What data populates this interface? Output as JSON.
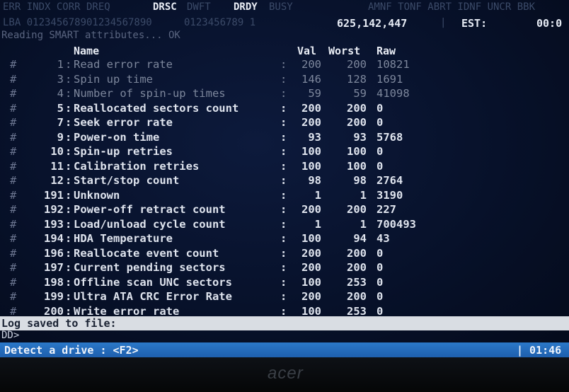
{
  "top": {
    "faded_left": "ERR INDX CORR DREQ",
    "drsc": "DRSC",
    "faded_mid": "DWFT",
    "drdy": "DRDY",
    "faded_mid2": "BUSY",
    "faded_right": "AMNF TONF ABRT IDNF UNCR BBK"
  },
  "info": {
    "faded_left": "LBA 012345678901234567890",
    "faded_mid": "0123456789 1",
    "lba_count": "625,142,447",
    "sep": "|",
    "est_label": "EST:",
    "est_value": "00:0"
  },
  "status_line": "Reading SMART attributes... OK",
  "columns": {
    "name": "Name",
    "val": "Val",
    "worst": "Worst",
    "raw": "Raw"
  },
  "attributes": [
    {
      "mark": "",
      "id": "1",
      "name": "Read error rate",
      "val": "200",
      "worst": "200",
      "raw": "10821",
      "dim": true
    },
    {
      "mark": "",
      "id": "3",
      "name": "Spin up time",
      "val": "146",
      "worst": "128",
      "raw": "1691",
      "dim": true
    },
    {
      "mark": "",
      "id": "4",
      "name": "Number of spin-up times",
      "val": "59",
      "worst": "59",
      "raw": "41098",
      "dim": true
    },
    {
      "mark": "",
      "id": "5",
      "name": "Reallocated sectors count",
      "val": "200",
      "worst": "200",
      "raw": "0",
      "dim": false
    },
    {
      "mark": "",
      "id": "7",
      "name": "Seek error rate",
      "val": "200",
      "worst": "200",
      "raw": "0",
      "dim": false
    },
    {
      "mark": "",
      "id": "9",
      "name": "Power-on time",
      "val": "93",
      "worst": "93",
      "raw": "5768",
      "dim": false
    },
    {
      "mark": "",
      "id": "10",
      "name": "Spin-up retries",
      "val": "100",
      "worst": "100",
      "raw": "0",
      "dim": false
    },
    {
      "mark": "",
      "id": "11",
      "name": "Calibration retries",
      "val": "100",
      "worst": "100",
      "raw": "0",
      "dim": false
    },
    {
      "mark": "",
      "id": "12",
      "name": "Start/stop count",
      "val": "98",
      "worst": "98",
      "raw": "2764",
      "dim": false
    },
    {
      "mark": "",
      "id": "191",
      "name": "Unknown",
      "val": "1",
      "worst": "1",
      "raw": "3190",
      "dim": false
    },
    {
      "mark": "",
      "id": "192",
      "name": "Power-off retract count",
      "val": "200",
      "worst": "200",
      "raw": "227",
      "dim": false
    },
    {
      "mark": "",
      "id": "193",
      "name": "Load/unload cycle count",
      "val": "1",
      "worst": "1",
      "raw": "700493",
      "dim": false
    },
    {
      "mark": "",
      "id": "194",
      "name": "HDA Temperature",
      "val": "100",
      "worst": "94",
      "raw": "43",
      "dim": false
    },
    {
      "mark": "",
      "id": "196",
      "name": "Reallocate event count",
      "val": "200",
      "worst": "200",
      "raw": "0",
      "dim": false
    },
    {
      "mark": "",
      "id": "197",
      "name": "Current pending sectors",
      "val": "200",
      "worst": "200",
      "raw": "0",
      "dim": false
    },
    {
      "mark": "",
      "id": "198",
      "name": "Offline scan UNC sectors",
      "val": "100",
      "worst": "253",
      "raw": "0",
      "dim": false
    },
    {
      "mark": "",
      "id": "199",
      "name": "Ultra ATA CRC Error Rate",
      "val": "200",
      "worst": "200",
      "raw": "0",
      "dim": false
    },
    {
      "mark": "",
      "id": "200",
      "name": "Write error rate",
      "val": "100",
      "worst": "253",
      "raw": "0",
      "dim": false
    }
  ],
  "log_bar": "Log saved to file:",
  "prompt": "DD>",
  "statusbar": {
    "hint": "Detect a drive : <F2>",
    "time": "| 01:46"
  },
  "bezel": {
    "brand": "acer"
  },
  "colors": {
    "status_bar": "#2b78c8",
    "log_bar": "#d9dde3",
    "screen_bg": "#07112a"
  }
}
